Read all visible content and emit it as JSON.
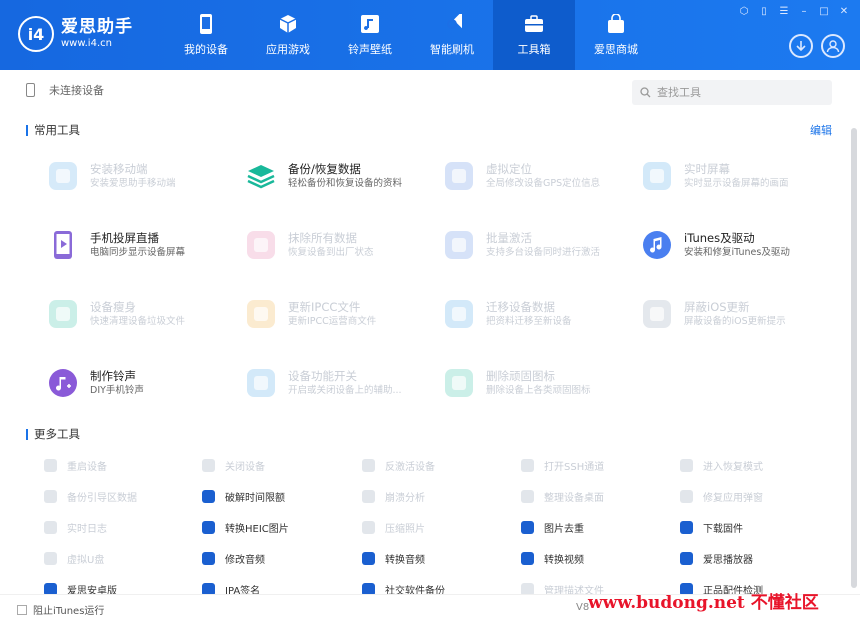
{
  "app": {
    "name": "爱思助手",
    "url": "www.i4.cn",
    "logo_mark": "i4"
  },
  "nav": [
    {
      "label": "我的设备",
      "icon": "phone-icon",
      "active": false
    },
    {
      "label": "应用游戏",
      "icon": "cube-icon",
      "active": false
    },
    {
      "label": "铃声壁纸",
      "icon": "music-note-icon",
      "active": false
    },
    {
      "label": "智能刷机",
      "icon": "refresh-icon",
      "active": false
    },
    {
      "label": "工具箱",
      "icon": "toolbox-icon",
      "active": true
    },
    {
      "label": "爱思商城",
      "icon": "shopping-bag-icon",
      "active": false
    }
  ],
  "device": {
    "status": "未连接设备"
  },
  "search": {
    "placeholder": "查找工具"
  },
  "common": {
    "title": "常用工具",
    "edit_label": "编辑",
    "tools": [
      {
        "title": "安装移动端",
        "desc": "安装爱思助手移动端",
        "enabled": false,
        "icon": "i4-app-icon",
        "color": "#4aa3e8"
      },
      {
        "title": "备份/恢复数据",
        "desc": "轻松备份和恢复设备的资料",
        "enabled": true,
        "icon": "layers-icon",
        "color": "#19b89a"
      },
      {
        "title": "虚拟定位",
        "desc": "全局修改设备GPS定位信息",
        "enabled": false,
        "icon": "location-pin-icon",
        "color": "#4a7fe0"
      },
      {
        "title": "实时屏幕",
        "desc": "实时显示设备屏幕的画面",
        "enabled": false,
        "icon": "screen-icon",
        "color": "#3aa0e6"
      },
      {
        "title": "手机投屏直播",
        "desc": "电脑同步显示设备屏幕",
        "enabled": true,
        "icon": "phone-play-icon",
        "color": "#8a6ad8"
      },
      {
        "title": "抹除所有数据",
        "desc": "恢复设备到出厂状态",
        "enabled": false,
        "icon": "eraser-icon",
        "color": "#e06aa0"
      },
      {
        "title": "批量激活",
        "desc": "支持多台设备同时进行激活",
        "enabled": false,
        "icon": "batch-activate-icon",
        "color": "#4a7fe0"
      },
      {
        "title": "iTunes及驱动",
        "desc": "安装和修复iTunes及驱动",
        "enabled": true,
        "icon": "itunes-icon",
        "color": "#4a7ff0"
      },
      {
        "title": "设备瘦身",
        "desc": "快速清理设备垃圾文件",
        "enabled": false,
        "icon": "slim-icon",
        "color": "#19b89a"
      },
      {
        "title": "更新IPCC文件",
        "desc": "更新IPCC运营商文件",
        "enabled": false,
        "icon": "ipcc-icon",
        "color": "#f0a830"
      },
      {
        "title": "迁移设备数据",
        "desc": "把资料迁移至新设备",
        "enabled": false,
        "icon": "migrate-icon",
        "color": "#3aa0e6"
      },
      {
        "title": "屏蔽iOS更新",
        "desc": "屏蔽设备的iOS更新提示",
        "enabled": false,
        "icon": "block-update-icon",
        "color": "#8a9ab0"
      },
      {
        "title": "制作铃声",
        "desc": "DIY手机铃声",
        "enabled": true,
        "icon": "ringtone-icon",
        "color": "#8a5ad8"
      },
      {
        "title": "设备功能开关",
        "desc": "开启或关闭设备上的辅助...",
        "enabled": false,
        "icon": "switch-icon",
        "color": "#3aa0e6"
      },
      {
        "title": "删除顽固图标",
        "desc": "删除设备上各类顽固图标",
        "enabled": false,
        "icon": "delete-icon-icon",
        "color": "#19b89a"
      }
    ]
  },
  "more": {
    "title": "更多工具",
    "tools": [
      {
        "label": "重启设备",
        "enabled": false,
        "icon": "restart-icon",
        "color": "#8a9ab0"
      },
      {
        "label": "关闭设备",
        "enabled": false,
        "icon": "power-icon",
        "color": "#8a9ab0"
      },
      {
        "label": "反激活设备",
        "enabled": false,
        "icon": "deactivate-icon",
        "color": "#8a9ab0"
      },
      {
        "label": "打开SSH通道",
        "enabled": false,
        "icon": "ssh-icon",
        "color": "#8a9ab0"
      },
      {
        "label": "进入恢复模式",
        "enabled": false,
        "icon": "recovery-icon",
        "color": "#8a9ab0"
      },
      {
        "label": "备份引导区数据",
        "enabled": false,
        "icon": "boot-backup-icon",
        "color": "#8a9ab0"
      },
      {
        "label": "破解时间限额",
        "enabled": true,
        "icon": "clock-icon",
        "color": "#1a5fd0"
      },
      {
        "label": "崩溃分析",
        "enabled": false,
        "icon": "crash-icon",
        "color": "#8a9ab0"
      },
      {
        "label": "整理设备桌面",
        "enabled": false,
        "icon": "desktop-icon",
        "color": "#8a9ab0"
      },
      {
        "label": "修复应用弹窗",
        "enabled": false,
        "icon": "repair-popup-icon",
        "color": "#8a9ab0"
      },
      {
        "label": "实时日志",
        "enabled": false,
        "icon": "log-icon",
        "color": "#8a9ab0"
      },
      {
        "label": "转换HEIC图片",
        "enabled": true,
        "icon": "heic-icon",
        "color": "#1a5fd0"
      },
      {
        "label": "压缩照片",
        "enabled": false,
        "icon": "compress-icon",
        "color": "#8a9ab0"
      },
      {
        "label": "图片去重",
        "enabled": true,
        "icon": "image-dedup-icon",
        "color": "#1a5fd0"
      },
      {
        "label": "下载固件",
        "enabled": true,
        "icon": "firmware-download-icon",
        "color": "#1a5fd0"
      },
      {
        "label": "虚拟U盘",
        "enabled": false,
        "icon": "usb-drive-icon",
        "color": "#8a9ab0"
      },
      {
        "label": "修改音频",
        "enabled": true,
        "icon": "audio-edit-icon",
        "color": "#1a5fd0"
      },
      {
        "label": "转换音频",
        "enabled": true,
        "icon": "audio-convert-icon",
        "color": "#1a5fd0"
      },
      {
        "label": "转换视频",
        "enabled": true,
        "icon": "video-convert-icon",
        "color": "#1a5fd0"
      },
      {
        "label": "爱思播放器",
        "enabled": true,
        "icon": "player-icon",
        "color": "#1a5fd0"
      },
      {
        "label": "爱思安卓版",
        "enabled": true,
        "icon": "android-icon",
        "color": "#1a5fd0"
      },
      {
        "label": "IPA签名",
        "enabled": true,
        "icon": "ipa-sign-icon",
        "color": "#1a5fd0"
      },
      {
        "label": "社交软件备份",
        "enabled": true,
        "icon": "social-backup-icon",
        "color": "#1a5fd0"
      },
      {
        "label": "管理描述文件",
        "enabled": false,
        "icon": "profile-icon",
        "color": "#8a9ab0"
      },
      {
        "label": "正品配件检测",
        "enabled": true,
        "icon": "accessory-check-icon",
        "color": "#1a5fd0"
      }
    ]
  },
  "footer": {
    "itunes_label": "阻止iTunes运行",
    "version": "V8"
  },
  "watermark": "www.budong.net 不懂社区"
}
